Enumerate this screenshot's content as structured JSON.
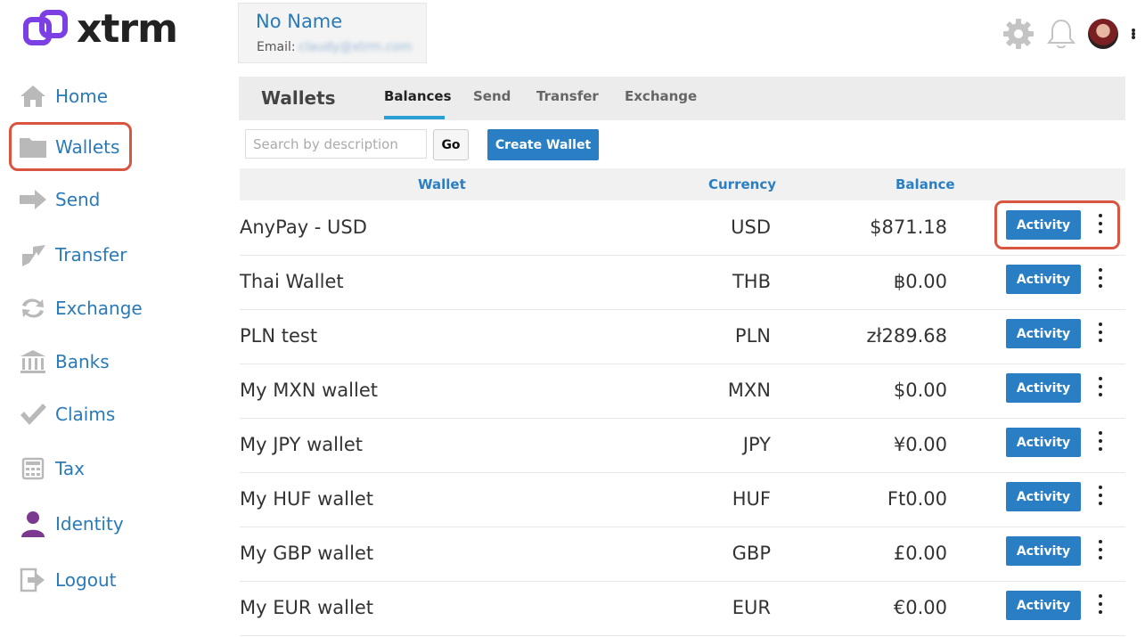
{
  "brand": {
    "name": "xtrm",
    "color": "#7b3fe4"
  },
  "user": {
    "name": "No Name",
    "email_label": "Email:",
    "email": "claudy@xtrm.com"
  },
  "sidebar": {
    "items": [
      {
        "label": "Home",
        "icon": "home-icon"
      },
      {
        "label": "Wallets",
        "icon": "folder-icon",
        "active": true
      },
      {
        "label": "Send",
        "icon": "arrow-right-icon"
      },
      {
        "label": "Transfer",
        "icon": "transfer-icon"
      },
      {
        "label": "Exchange",
        "icon": "exchange-icon"
      },
      {
        "label": "Banks",
        "icon": "bank-icon"
      },
      {
        "label": "Claims",
        "icon": "checkmark-icon"
      },
      {
        "label": "Tax",
        "icon": "calculator-icon"
      },
      {
        "label": "Identity",
        "icon": "person-icon"
      },
      {
        "label": "Logout",
        "icon": "logout-icon"
      }
    ]
  },
  "header": {
    "title": "Wallets",
    "tabs": [
      {
        "label": "Balances",
        "active": true
      },
      {
        "label": "Send"
      },
      {
        "label": "Transfer"
      },
      {
        "label": "Exchange"
      }
    ]
  },
  "toolbar": {
    "search_placeholder": "Search by description",
    "go_label": "Go",
    "create_label": "Create Wallet"
  },
  "table": {
    "columns": {
      "wallet": "Wallet",
      "currency": "Currency",
      "balance": "Balance"
    },
    "action_label": "Activity",
    "rows": [
      {
        "name": "AnyPay - USD",
        "currency": "USD",
        "balance": "$871.18"
      },
      {
        "name": "Thai Wallet",
        "currency": "THB",
        "balance": "฿0.00"
      },
      {
        "name": "PLN test",
        "currency": "PLN",
        "balance": "zł289.68"
      },
      {
        "name": "My MXN wallet",
        "currency": "MXN",
        "balance": "$0.00"
      },
      {
        "name": "My JPY wallet",
        "currency": "JPY",
        "balance": "¥0.00"
      },
      {
        "name": "My HUF wallet",
        "currency": "HUF",
        "balance": "Ft0.00"
      },
      {
        "name": "My GBP wallet",
        "currency": "GBP",
        "balance": "£0.00"
      },
      {
        "name": "My EUR wallet",
        "currency": "EUR",
        "balance": "€0.00"
      }
    ]
  },
  "colors": {
    "accent": "#2a7fc4",
    "highlight": "#d9553f",
    "nav_text": "#2a7ab8"
  }
}
